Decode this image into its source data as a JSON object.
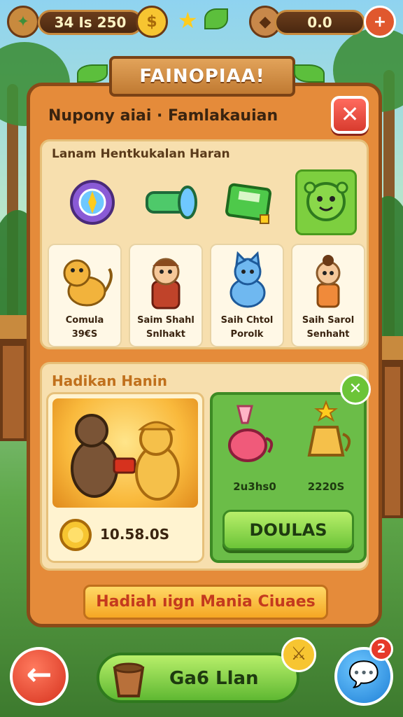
{
  "topbar": {
    "coins": "34 Is 250",
    "gems": "0.0",
    "plus_label": "+"
  },
  "banner": {
    "title": "FAINOPIAA!"
  },
  "panel": {
    "header": "Nupony aiai · Famlakauian",
    "close_label": "✕"
  },
  "category": {
    "title": "Lanam Hentkukalan Haran",
    "tabs": [
      {
        "icon": "compass-icon"
      },
      {
        "icon": "tube-icon"
      },
      {
        "icon": "cash-register-icon"
      },
      {
        "icon": "green-creature-icon",
        "active": true
      }
    ],
    "cards": [
      {
        "line1": "Comula",
        "line2": "39€S"
      },
      {
        "line1": "Saim Shahl",
        "line2": "Snlhakt"
      },
      {
        "line1": "Saih Chtol",
        "line2": "Porolk"
      },
      {
        "line1": "Saih Sarol",
        "line2": "Senhaht"
      }
    ]
  },
  "rewards": {
    "title": "Hadikan Hanin",
    "left_value": "10.58.0S",
    "right_items": [
      {
        "value": "2u3hs0"
      },
      {
        "value": "2220S"
      }
    ],
    "dismiss_label": "✕",
    "button_label": "DOULAS"
  },
  "promo": {
    "label": "Hadiah ıign Mania Ciuaes"
  },
  "bottom": {
    "main_label": "Ga6 Llan",
    "chat_badge": "2"
  },
  "colors": {
    "panel": "#e58b3a",
    "accent_green": "#6cc438",
    "close_red": "#d83b2e",
    "gold": "#f5a623"
  }
}
